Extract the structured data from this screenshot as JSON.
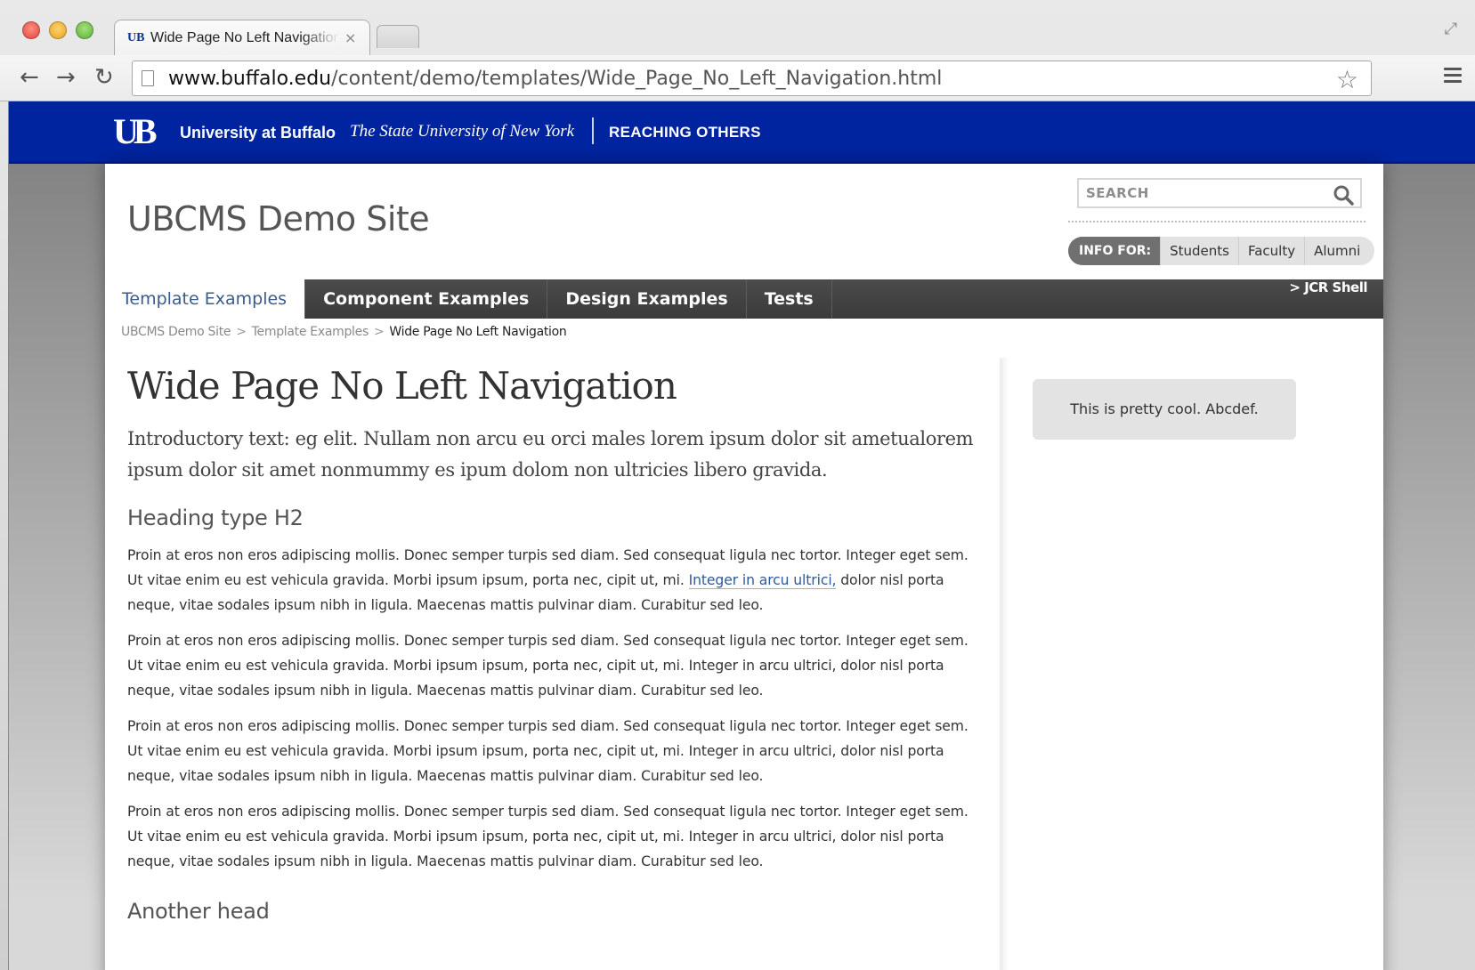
{
  "browser": {
    "tab_favicon": "UB",
    "tab_title": "Wide Page No Left Navigation",
    "tab_close": "×",
    "url_host": "www.buffalo.edu",
    "url_path": "/content/demo/templates/Wide_Page_No_Left_Navigation.html",
    "back_icon": "←",
    "forward_icon": "→",
    "reload_icon": "↻",
    "star_icon": "☆"
  },
  "ub_bar": {
    "logo": "UB",
    "name": "University at Buffalo",
    "tagline": "The State University of New York",
    "reaching": "REACHING OTHERS"
  },
  "header": {
    "site_title": "UBCMS Demo Site",
    "search_placeholder": "SEARCH",
    "info_for_label": "INFO FOR:",
    "info_links": [
      "Students",
      "Faculty",
      "Alumni"
    ]
  },
  "nav": {
    "tabs": [
      "Template Examples",
      "Component Examples",
      "Design Examples",
      "Tests"
    ],
    "jcr_shell": "> JCR Shell"
  },
  "breadcrumb": {
    "items": [
      "UBCMS Demo Site",
      "Template Examples"
    ],
    "separator": ">",
    "current": "Wide Page No Left Navigation"
  },
  "content": {
    "title": "Wide Page No Left Navigation",
    "intro": "Introductory text: eg elit. Nullam non arcu eu orci males lorem ipsum dolor sit ametualorem ipsum dolor sit amet nonmummy es ipum dolom non ultricies libero gravida.",
    "heading_h2": "Heading type H2",
    "para_before_link": "Proin at eros non eros adipiscing mollis. Donec semper turpis sed diam. Sed consequat ligula nec tortor. Integer eget sem. Ut vitae enim eu est vehicula gravida. Morbi ipsum ipsum, porta nec, cipit ut, mi. ",
    "para_link": "Integer in arcu ultrici,",
    "para_after_link": " dolor nisl porta neque, vitae sodales ipsum nibh in ligula. Maecenas mattis pulvinar diam. Curabitur sed leo.",
    "paragraph": "Proin at eros non eros adipiscing mollis. Donec semper turpis sed diam. Sed consequat ligula nec tortor. Integer eget sem. Ut vitae enim eu est vehicula gravida. Morbi ipsum ipsum, porta nec, cipit ut, mi. Integer in arcu ultrici, dolor nisl porta neque, vitae sodales ipsum nibh in ligula. Maecenas mattis pulvinar diam. Curabitur sed leo.",
    "another_head": "Another head"
  },
  "sidebar": {
    "callout": "This is pretty cool. Abcdef."
  },
  "colors": {
    "ub_blue": "#0024a0",
    "nav_dark": "#444444",
    "link_blue": "#2e5a9a"
  }
}
